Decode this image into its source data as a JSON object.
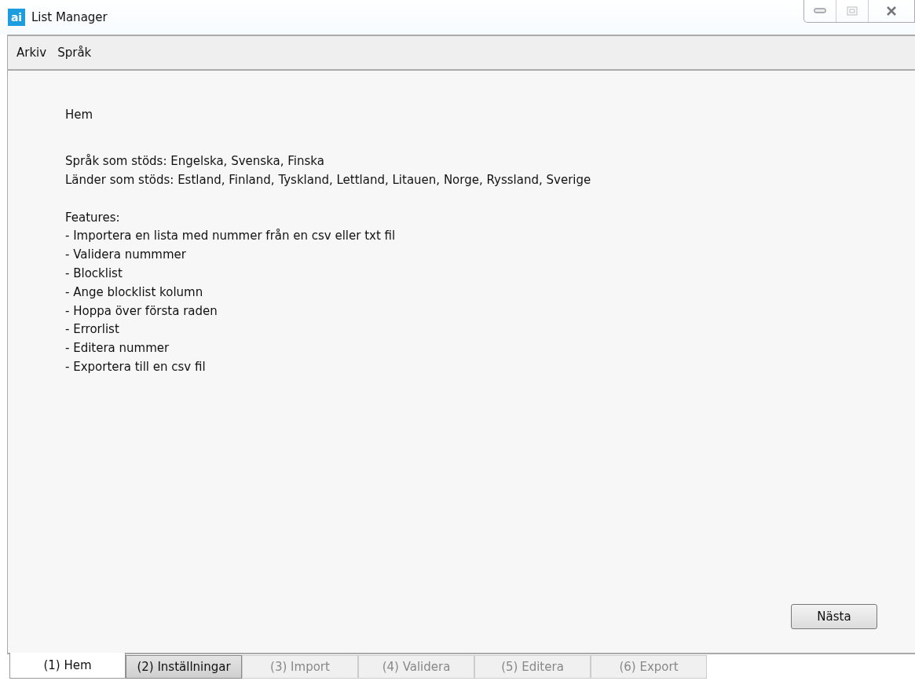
{
  "window": {
    "title": "List Manager",
    "logo": "ai"
  },
  "menu": [
    "Arkiv",
    "Språk"
  ],
  "content": {
    "heading": "Hem",
    "info": [
      "Språk som stöds: Engelska, Svenska, Finska",
      "Länder som stöds: Estland, Finland, Tyskland, Lettland, Litauen, Norge, Ryssland, Sverige"
    ],
    "features_title": "Features:",
    "features": [
      "- Importera en lista med nummer från en csv eller txt fil",
      "- Validera nummmer",
      "- Blocklist",
      "- Ange blocklist kolumn",
      "- Hoppa över första raden",
      "- Errorlist",
      "- Editera nummer",
      "- Exportera till en csv fil"
    ]
  },
  "next_button": "Nästa",
  "tabs": [
    {
      "label": "(1) Hem",
      "selected": true,
      "disabled": false,
      "hovered": false
    },
    {
      "label": "(2) Inställningar",
      "selected": false,
      "disabled": false,
      "hovered": true
    },
    {
      "label": "(3) Import",
      "selected": false,
      "disabled": true,
      "hovered": false
    },
    {
      "label": "(4) Validera",
      "selected": false,
      "disabled": true,
      "hovered": false
    },
    {
      "label": "(5) Editera",
      "selected": false,
      "disabled": true,
      "hovered": false
    },
    {
      "label": "(6) Export",
      "selected": false,
      "disabled": true,
      "hovered": false
    }
  ]
}
